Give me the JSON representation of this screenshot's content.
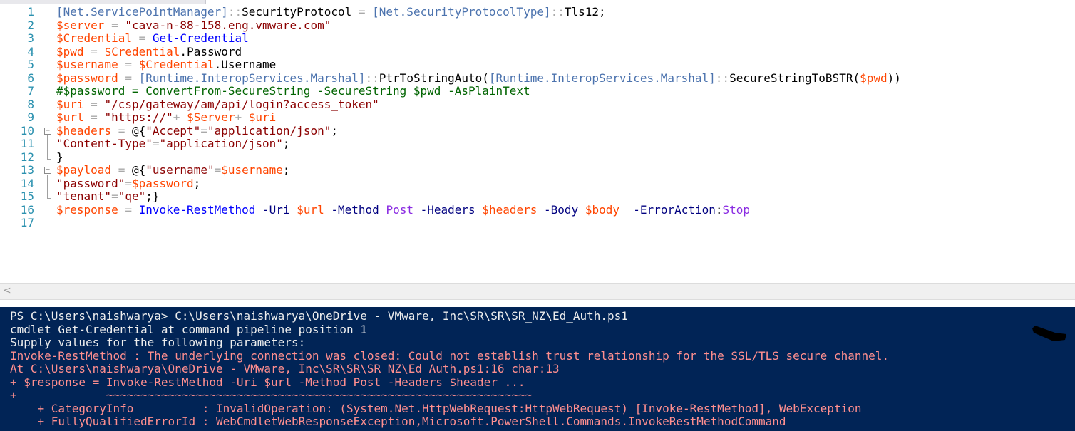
{
  "editor": {
    "lines": [
      {
        "n": "1",
        "tokens": [
          [
            "type",
            "[Net.ServicePointManager]"
          ],
          [
            "op",
            "::"
          ],
          [
            "plain",
            "SecurityProtocol "
          ],
          [
            "op",
            "="
          ],
          [
            "plain",
            " "
          ],
          [
            "type",
            "[Net.SecurityProtocolType]"
          ],
          [
            "op",
            "::"
          ],
          [
            "plain",
            "Tls12;"
          ]
        ]
      },
      {
        "n": "2",
        "tokens": [
          [
            "var",
            "$server"
          ],
          [
            "plain",
            " "
          ],
          [
            "op",
            "="
          ],
          [
            "plain",
            " "
          ],
          [
            "str",
            "\"cava-n-88-158.eng.vmware.com\""
          ]
        ]
      },
      {
        "n": "3",
        "tokens": [
          [
            "var",
            "$Credential"
          ],
          [
            "plain",
            " "
          ],
          [
            "op",
            "="
          ],
          [
            "plain",
            " "
          ],
          [
            "cmd",
            "Get-Credential"
          ]
        ]
      },
      {
        "n": "4",
        "tokens": [
          [
            "var",
            "$pwd"
          ],
          [
            "plain",
            " "
          ],
          [
            "op",
            "="
          ],
          [
            "plain",
            " "
          ],
          [
            "var",
            "$Credential"
          ],
          [
            "plain",
            ".Password"
          ]
        ]
      },
      {
        "n": "5",
        "tokens": [
          [
            "var",
            "$username"
          ],
          [
            "plain",
            " "
          ],
          [
            "op",
            "="
          ],
          [
            "plain",
            " "
          ],
          [
            "var",
            "$Credential"
          ],
          [
            "plain",
            ".Username"
          ]
        ]
      },
      {
        "n": "6",
        "tokens": [
          [
            "var",
            "$password"
          ],
          [
            "plain",
            " "
          ],
          [
            "op",
            "="
          ],
          [
            "plain",
            " "
          ],
          [
            "type",
            "[Runtime.InteropServices.Marshal]"
          ],
          [
            "op",
            "::"
          ],
          [
            "plain",
            "PtrToStringAuto("
          ],
          [
            "type",
            "[Runtime.InteropServices.Marshal]"
          ],
          [
            "op",
            "::"
          ],
          [
            "plain",
            "SecureStringToBSTR("
          ],
          [
            "var",
            "$pwd"
          ],
          [
            "plain",
            "))"
          ]
        ]
      },
      {
        "n": "7",
        "tokens": [
          [
            "cmt",
            "#$password = ConvertFrom-SecureString -SecureString $pwd -AsPlainText"
          ]
        ]
      },
      {
        "n": "8",
        "tokens": [
          [
            "var",
            "$uri"
          ],
          [
            "plain",
            " "
          ],
          [
            "op",
            "="
          ],
          [
            "plain",
            " "
          ],
          [
            "str",
            "\"/csp/gateway/am/api/login?access_token\""
          ]
        ]
      },
      {
        "n": "9",
        "tokens": [
          [
            "var",
            "$url"
          ],
          [
            "plain",
            " "
          ],
          [
            "op",
            "="
          ],
          [
            "plain",
            " "
          ],
          [
            "str",
            "\"https://\""
          ],
          [
            "op",
            "+"
          ],
          [
            "plain",
            " "
          ],
          [
            "var",
            "$Server"
          ],
          [
            "op",
            "+"
          ],
          [
            "plain",
            " "
          ],
          [
            "var",
            "$uri"
          ]
        ]
      },
      {
        "n": "10",
        "fold": "−",
        "tokens": [
          [
            "var",
            "$headers"
          ],
          [
            "plain",
            " "
          ],
          [
            "op",
            "="
          ],
          [
            "plain",
            " @{"
          ],
          [
            "str",
            "\"Accept\""
          ],
          [
            "op",
            "="
          ],
          [
            "str",
            "\"application/json\""
          ],
          [
            "plain",
            ";"
          ]
        ]
      },
      {
        "n": "11",
        "tokens": [
          [
            "str",
            "\"Content-Type\""
          ],
          [
            "op",
            "="
          ],
          [
            "str",
            "\"application/json\""
          ],
          [
            "plain",
            ";"
          ]
        ]
      },
      {
        "n": "12",
        "tokens": [
          [
            "plain",
            "}"
          ]
        ]
      },
      {
        "n": "13",
        "fold": "−",
        "tokens": [
          [
            "var",
            "$payload"
          ],
          [
            "plain",
            " "
          ],
          [
            "op",
            "="
          ],
          [
            "plain",
            " @{"
          ],
          [
            "str",
            "\"username\""
          ],
          [
            "op",
            "="
          ],
          [
            "var",
            "$username"
          ],
          [
            "plain",
            ";"
          ]
        ]
      },
      {
        "n": "14",
        "tokens": [
          [
            "str",
            "\"password\""
          ],
          [
            "op",
            "="
          ],
          [
            "var",
            "$password"
          ],
          [
            "plain",
            ";"
          ]
        ]
      },
      {
        "n": "15",
        "tokens": [
          [
            "str",
            "\"tenant\""
          ],
          [
            "op",
            "="
          ],
          [
            "str",
            "\"qe\""
          ],
          [
            "plain",
            ";}"
          ]
        ]
      },
      {
        "n": "16",
        "tokens": [
          [
            "var",
            "$response"
          ],
          [
            "plain",
            " "
          ],
          [
            "op",
            "="
          ],
          [
            "plain",
            " "
          ],
          [
            "cmd",
            "Invoke-RestMethod"
          ],
          [
            "plain",
            " "
          ],
          [
            "param",
            "-Uri"
          ],
          [
            "plain",
            " "
          ],
          [
            "var",
            "$url"
          ],
          [
            "plain",
            " "
          ],
          [
            "param",
            "-Method"
          ],
          [
            "plain",
            " "
          ],
          [
            "kw",
            "Post"
          ],
          [
            "plain",
            " "
          ],
          [
            "param",
            "-Headers"
          ],
          [
            "plain",
            " "
          ],
          [
            "var",
            "$headers"
          ],
          [
            "plain",
            " "
          ],
          [
            "param",
            "-Body"
          ],
          [
            "plain",
            " "
          ],
          [
            "var",
            "$body"
          ],
          [
            "plain",
            "  "
          ],
          [
            "param",
            "-ErrorAction"
          ],
          [
            "plain",
            ":"
          ],
          [
            "kw",
            "Stop"
          ]
        ]
      },
      {
        "n": "17",
        "tokens": []
      }
    ]
  },
  "scrollbar": {
    "left_arrow": "<"
  },
  "console": {
    "lines": [
      {
        "style": "white",
        "text": "PS C:\\Users\\naishwarya> C:\\Users\\naishwarya\\OneDrive - VMware, Inc\\SR\\SR\\SR_NZ\\Ed_Auth.ps1"
      },
      {
        "style": "white",
        "text": "cmdlet Get-Credential at command pipeline position 1"
      },
      {
        "style": "white",
        "text": "Supply values for the following parameters:"
      },
      {
        "style": "red",
        "text": "Invoke-RestMethod : The underlying connection was closed: Could not establish trust relationship for the SSL/TLS secure channel."
      },
      {
        "style": "red",
        "text": "At C:\\Users\\naishwarya\\OneDrive - VMware, Inc\\SR\\SR\\SR_NZ\\Ed_Auth.ps1:16 char:13"
      },
      {
        "style": "red",
        "text": "+ $response = Invoke-RestMethod -Uri $url -Method Post -Headers $header ..."
      },
      {
        "style": "red",
        "text": "+             ~~~~~~~~~~~~~~~~~~~~~~~~~~~~~~~~~~~~~~~~~~~~~~~~~~~~~~~~~~~~~~"
      },
      {
        "style": "red",
        "text": "    + CategoryInfo          : InvalidOperation: (System.Net.HttpWebRequest:HttpWebRequest) [Invoke-RestMethod], WebException"
      },
      {
        "style": "red",
        "text": "    + FullyQualifiedErrorId : WebCmdletWebResponseException,Microsoft.PowerShell.Commands.InvokeRestMethodCommand"
      }
    ]
  }
}
